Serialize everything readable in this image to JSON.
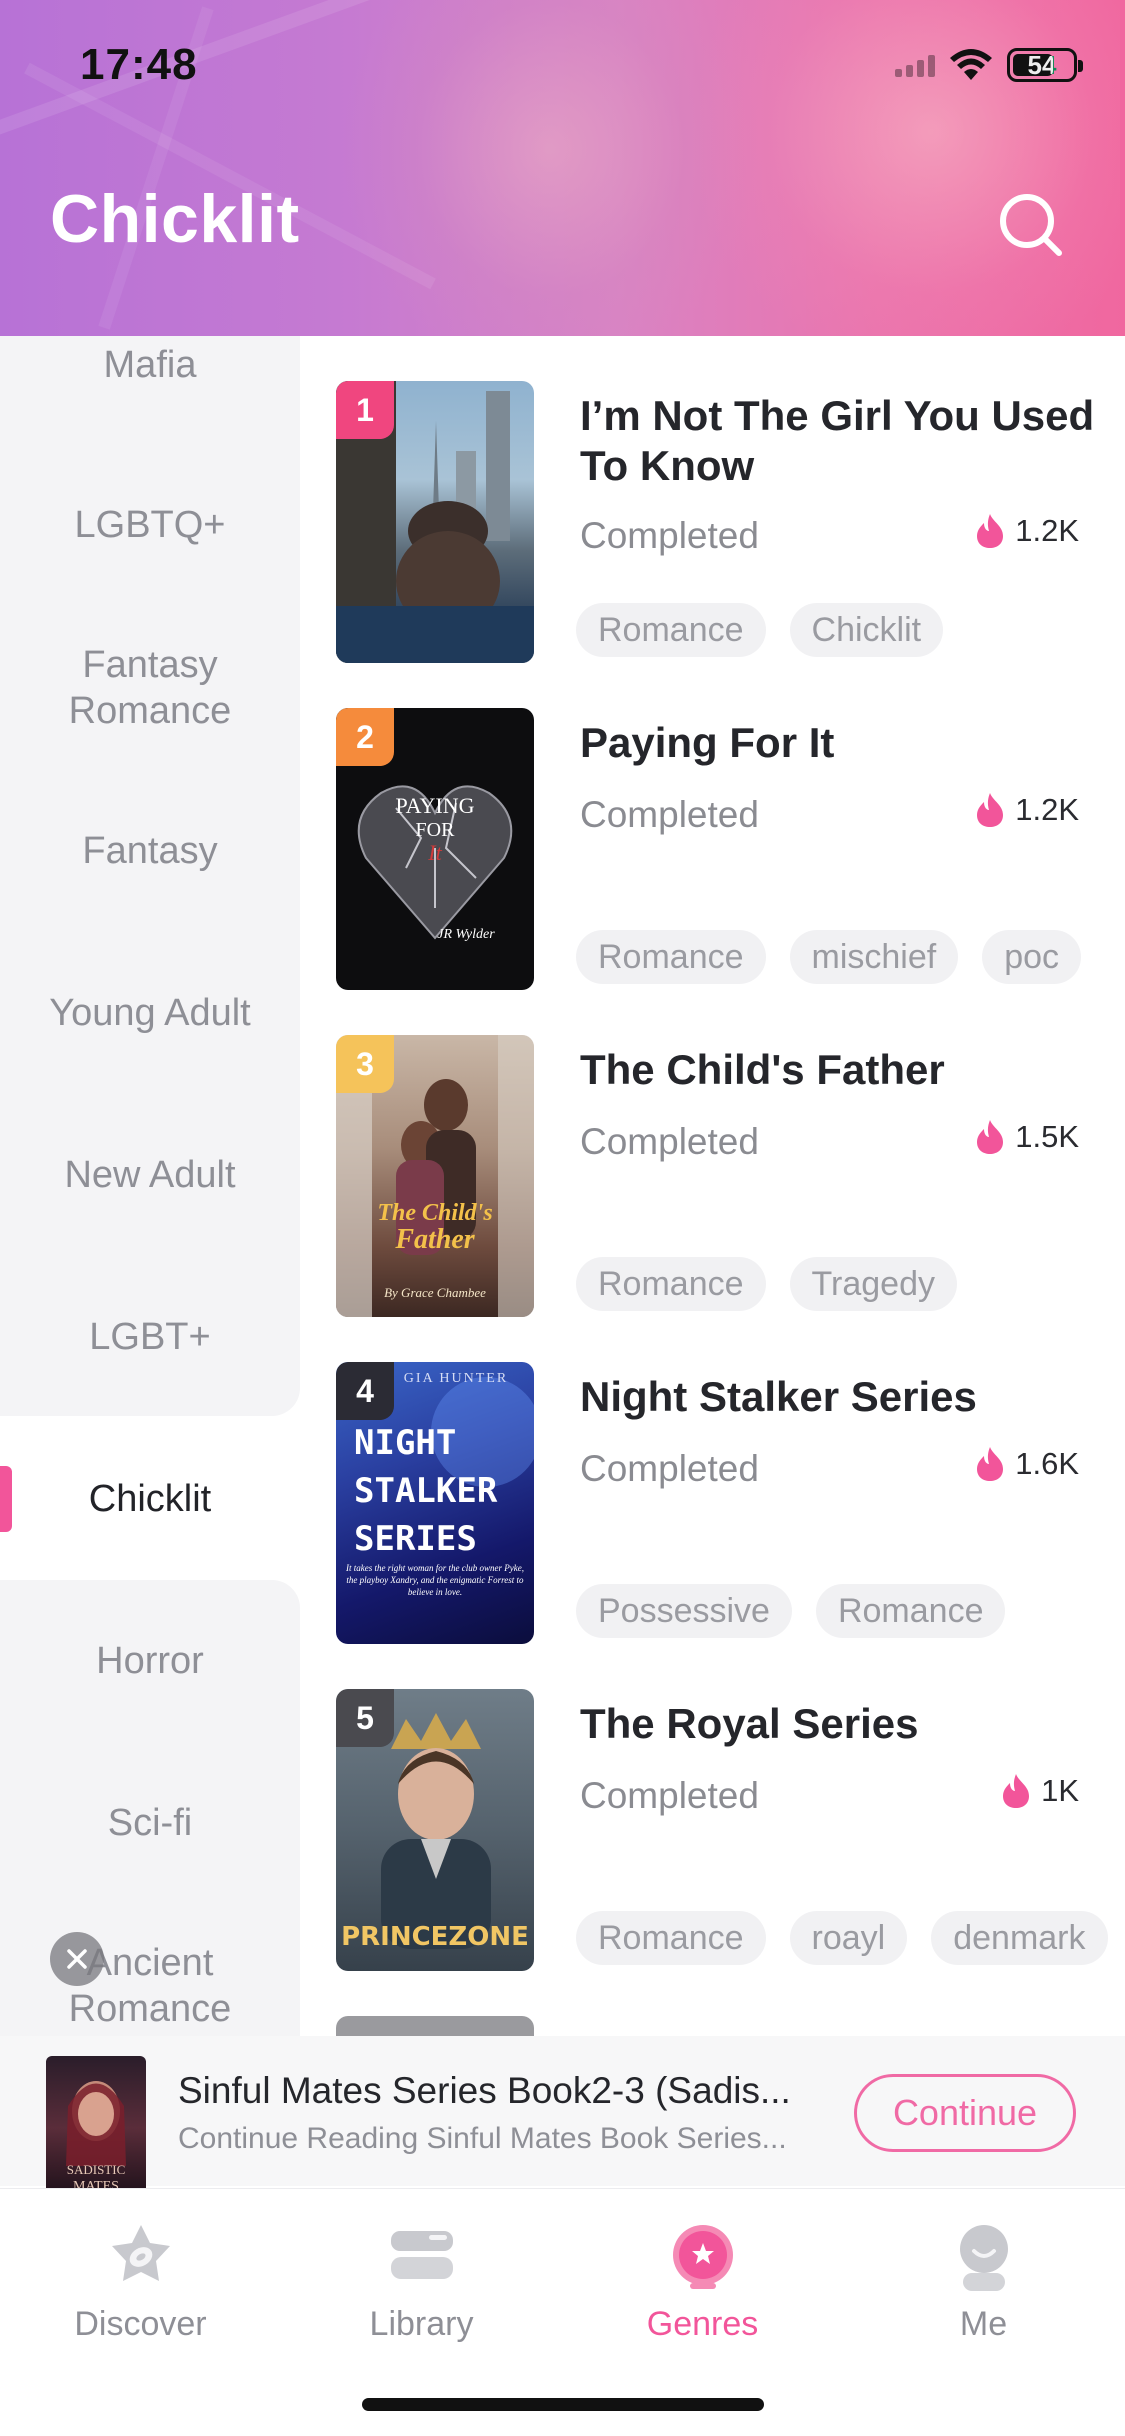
{
  "status_bar": {
    "time": "17:48",
    "battery": "54"
  },
  "header": {
    "title": "Chicklit"
  },
  "sidebar": {
    "items": [
      {
        "label": "Mafia"
      },
      {
        "label": "LGBTQ+"
      },
      {
        "label": "Fantasy Romance"
      },
      {
        "label": "Fantasy"
      },
      {
        "label": "Young Adult"
      },
      {
        "label": "New Adult"
      },
      {
        "label": "LGBT+"
      },
      {
        "label": "Chicklit",
        "active": true
      },
      {
        "label": "Horror"
      },
      {
        "label": "Sci-fi"
      },
      {
        "label": "Ancient Romance"
      }
    ]
  },
  "books": [
    {
      "rank": "1",
      "title": "I’m Not The Girl You Used To Know",
      "status": "Completed",
      "heat": "1.2K",
      "tags": [
        "Romance",
        "Chicklit"
      ]
    },
    {
      "rank": "2",
      "title": "Paying For It",
      "status": "Completed",
      "heat": "1.2K",
      "tags": [
        "Romance",
        "mischief",
        "poc"
      ]
    },
    {
      "rank": "3",
      "title": "The Child's Father",
      "status": "Completed",
      "heat": "1.5K",
      "tags": [
        "Romance",
        "Tragedy"
      ]
    },
    {
      "rank": "4",
      "title": "Night Stalker Series",
      "status": "Completed",
      "heat": "1.6K",
      "tags": [
        "Possessive",
        "Romance"
      ]
    },
    {
      "rank": "5",
      "title": "The Royal Series",
      "status": "Completed",
      "heat": "1K",
      "tags": [
        "Romance",
        "roayl",
        "denmark"
      ]
    }
  ],
  "covers": {
    "paying_for_it": {
      "line1": "PAYING",
      "line2": "FOR",
      "author": "JR Wylder"
    },
    "childs_father": {
      "title1": "The Child's",
      "title2": "Father",
      "author": "By Grace Chambee"
    },
    "night_stalker": {
      "author": "GIA HUNTER",
      "line1": "NIGHT",
      "line2": "STALKER",
      "line3": "SERIES",
      "blurb": "It takes the right woman for the club owner Pyke, the playboy Xandry, and the enigmatic Forrest to believe in love."
    },
    "royal": {
      "brand": "PRINCEZONE"
    },
    "sadistic": {
      "line1": "SADISTIC",
      "line2": "MATES"
    }
  },
  "continue_reading": {
    "title": "Sinful Mates Series Book2-3 (Sadis...",
    "subtitle": "Continue Reading Sinful Mates Book Series...",
    "button": "Continue"
  },
  "tabbar": {
    "tabs": [
      {
        "label": "Discover",
        "icon": "discover-icon"
      },
      {
        "label": "Library",
        "icon": "library-icon"
      },
      {
        "label": "Genres",
        "icon": "genres-icon",
        "active": true
      },
      {
        "label": "Me",
        "icon": "me-icon"
      }
    ]
  },
  "colors": {
    "accent": "#f2559a",
    "rank1": "#f0467f",
    "rank2": "#f58b3c",
    "rank3": "#f5c35a",
    "rank4": "#2b2b34",
    "rank5": "#4a4a4f",
    "flame": "#f2559a"
  }
}
